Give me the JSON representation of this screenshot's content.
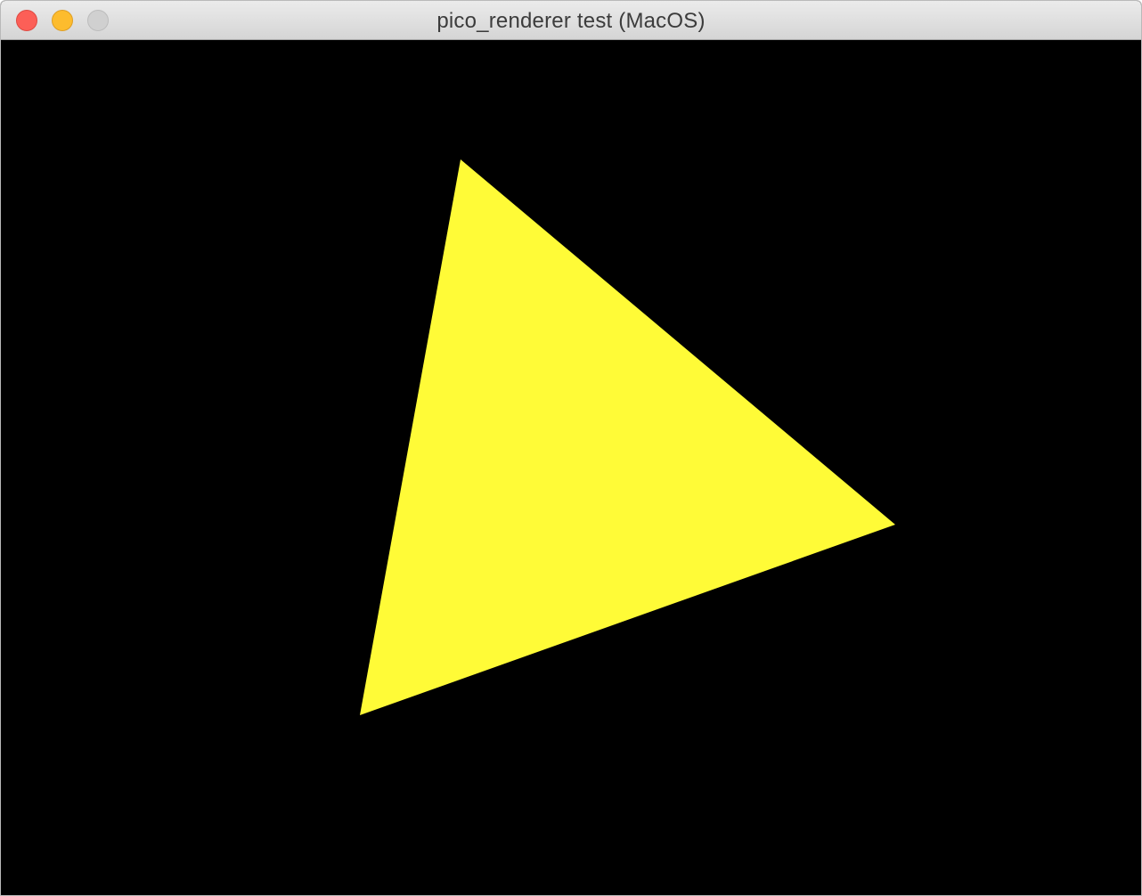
{
  "window": {
    "title": "pico_renderer test (MacOS)"
  },
  "controls": {
    "close_icon": "red-circle",
    "minimize_icon": "yellow-circle",
    "zoom_icon": "grey-circle"
  },
  "colors": {
    "background": "#000000",
    "triangle_fill": "#fffb37",
    "close": "#fc5f57",
    "minimize": "#fdbc2e",
    "zoom_disabled": "#d0d0d0"
  }
}
